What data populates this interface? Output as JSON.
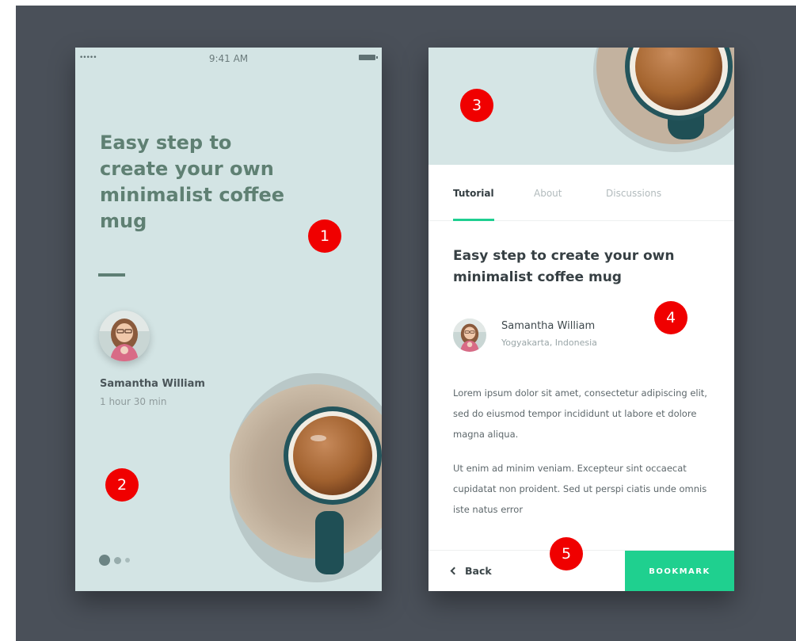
{
  "screen1": {
    "status": {
      "signal": "•••••",
      "time": "9:41 AM"
    },
    "title": "Easy step to create your own minimalist coffee mug",
    "author": {
      "name": "Samantha William",
      "duration": "1 hour 30 min"
    },
    "pagination": {
      "total": 3,
      "active": 1
    }
  },
  "screen2": {
    "tabs": [
      {
        "label": "Tutorial",
        "active": true
      },
      {
        "label": "About",
        "active": false
      },
      {
        "label": "Discussions",
        "active": false
      }
    ],
    "title": "Easy step to create your own minimalist coffee mug",
    "author": {
      "name": "Samantha William",
      "location": "Yogyakarta, Indonesia"
    },
    "paragraphs": [
      "Lorem ipsum dolor sit amet, consectetur adipiscing elit, sed do eiusmod tempor incididunt ut labore et dolore magna aliqua.",
      "Ut enim ad minim veniam. Excepteur sint occaecat cupidatat non proident. Sed ut perspi ciatis unde omnis iste natus error"
    ],
    "back_label": "Back",
    "bookmark_label": "BOOKMARK"
  },
  "markers": [
    "1",
    "2",
    "3",
    "4",
    "5"
  ],
  "colors": {
    "background": "#4a5059",
    "screen_bg": "#d3e4e4",
    "title": "#5f8073",
    "accent": "#1fd08f",
    "marker": "#f00000"
  },
  "icons": [
    "signal-icon",
    "battery-icon",
    "chevron-left-icon"
  ]
}
